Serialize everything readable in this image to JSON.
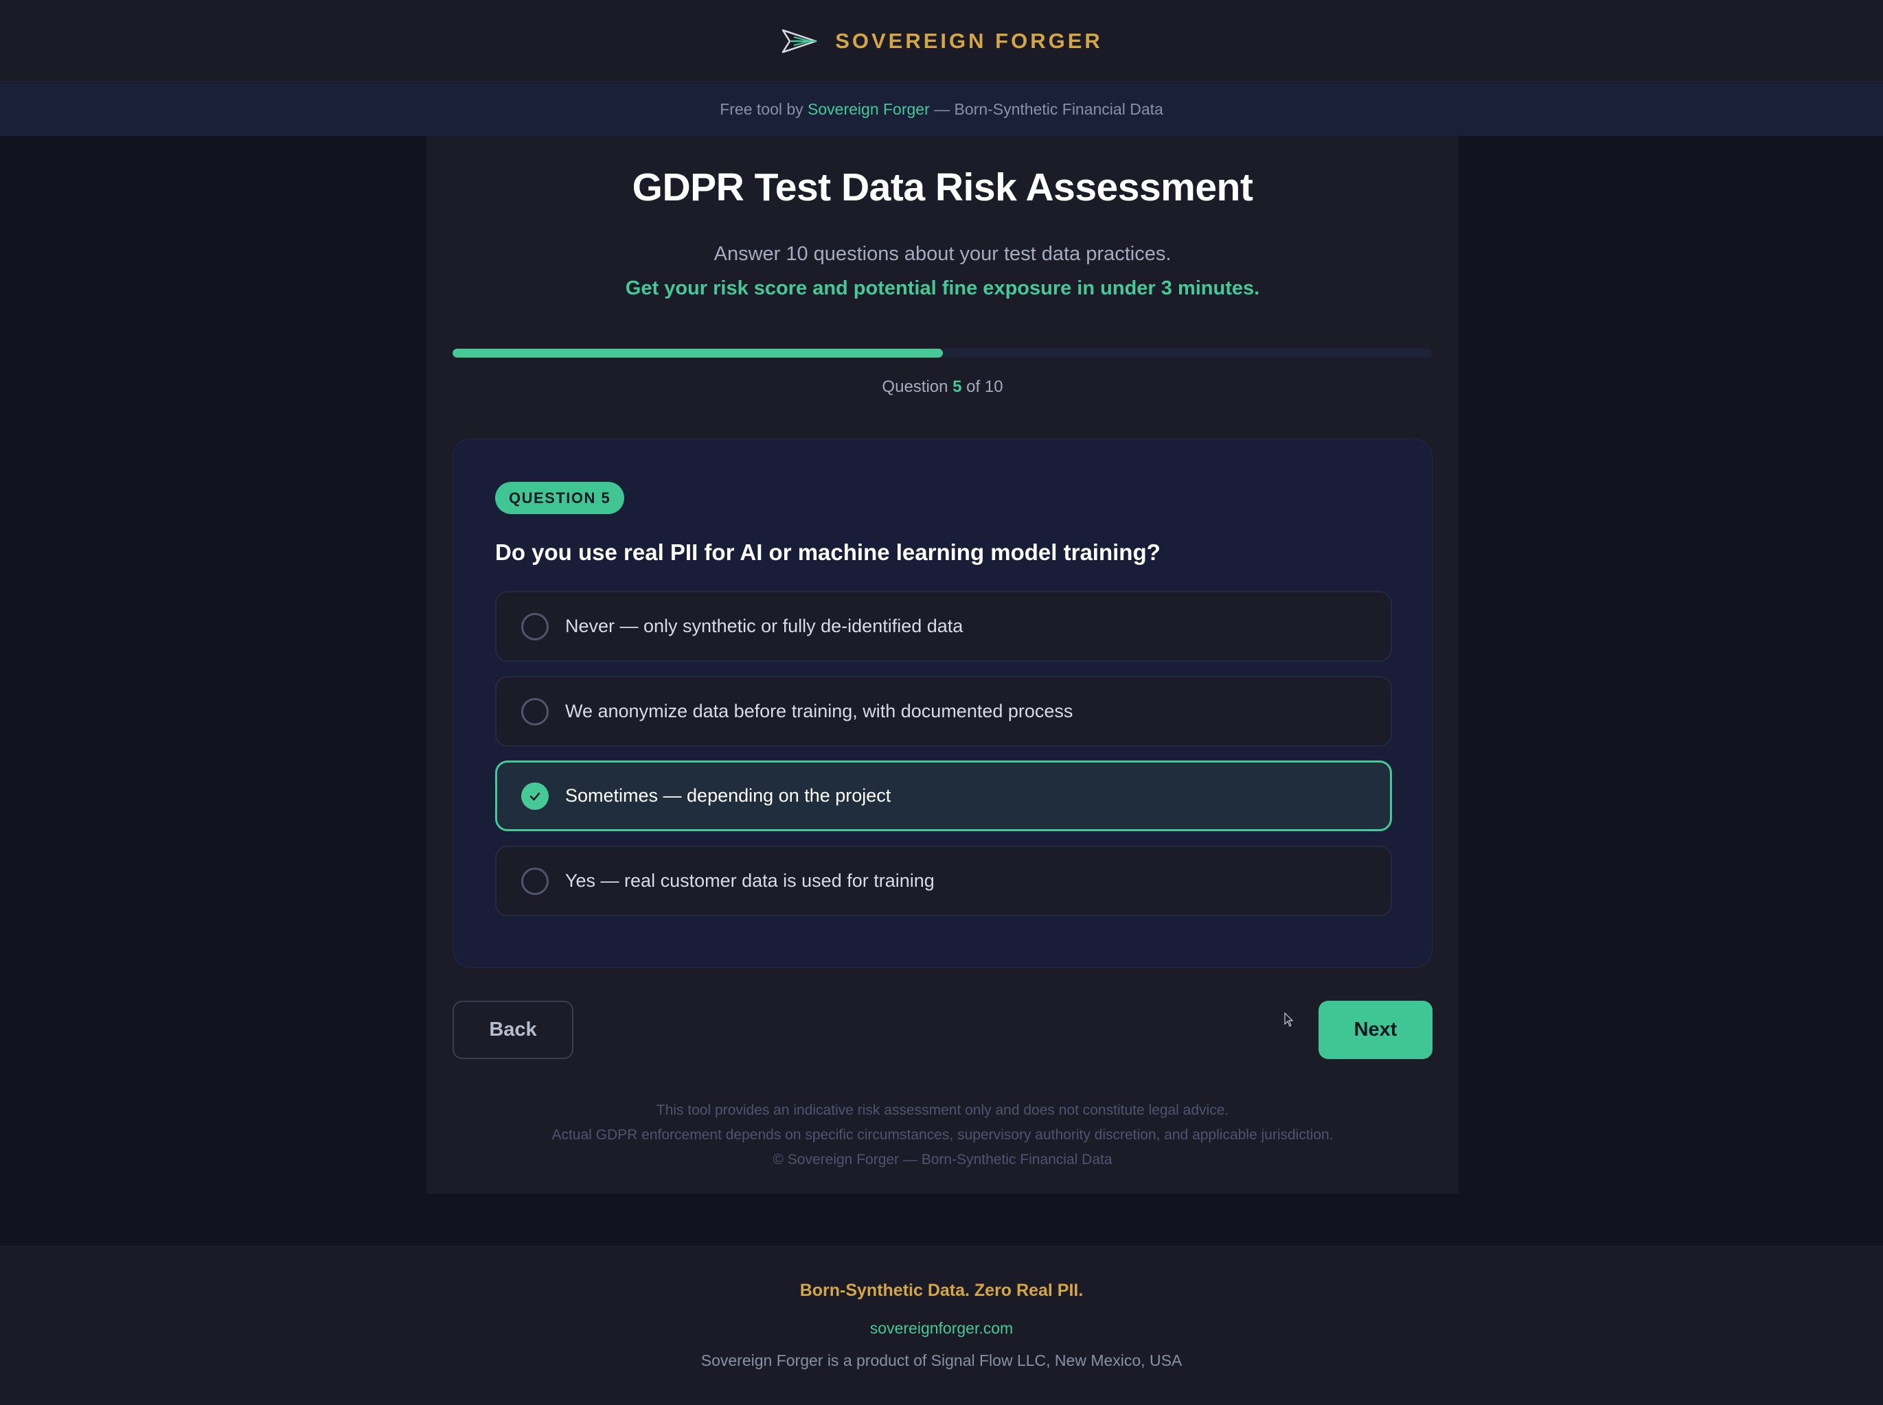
{
  "header": {
    "brand_name": "SOVEREIGN FORGER",
    "logo_icon": "paper-plane-forge-logo"
  },
  "subbar": {
    "prefix": "Free tool by ",
    "link_text": "Sovereign Forger",
    "suffix": " — Born-Synthetic Financial Data"
  },
  "hero": {
    "title": "GDPR Test Data Risk Assessment",
    "subtitle": "Answer 10 questions about your test data practices.",
    "tagline": "Get your risk score and potential fine exposure in under 3 minutes."
  },
  "progress": {
    "fraction": 0.5,
    "label_prefix": "Question ",
    "current": "5",
    "label_suffix": " of 10"
  },
  "question": {
    "badge": "QUESTION 5",
    "text": "Do you use real PII for AI or machine learning model training?",
    "options": [
      {
        "label": "Never — only synthetic or fully de-identified data",
        "selected": false
      },
      {
        "label": "We anonymize data before training, with documented process",
        "selected": false
      },
      {
        "label": "Sometimes — depending on the project",
        "selected": true
      },
      {
        "label": "Yes — real customer data is used for training",
        "selected": false
      }
    ]
  },
  "nav": {
    "back_label": "Back",
    "next_label": "Next"
  },
  "disclaimer": {
    "line1": "This tool provides an indicative risk assessment only and does not constitute legal advice.",
    "line2": "Actual GDPR enforcement depends on specific circumstances, supervisory authority discretion, and applicable jurisdiction.",
    "line3": "© Sovereign Forger — Born-Synthetic Financial Data"
  },
  "footer": {
    "tagline": "Born-Synthetic Data. Zero Real PII.",
    "site": "sovereignforger.com",
    "company": "Sovereign Forger is a product of Signal Flow LLC, New Mexico, USA"
  },
  "colors": {
    "accent": "#44c997",
    "brand_gold": "#d4a745",
    "background": "#13131f"
  }
}
